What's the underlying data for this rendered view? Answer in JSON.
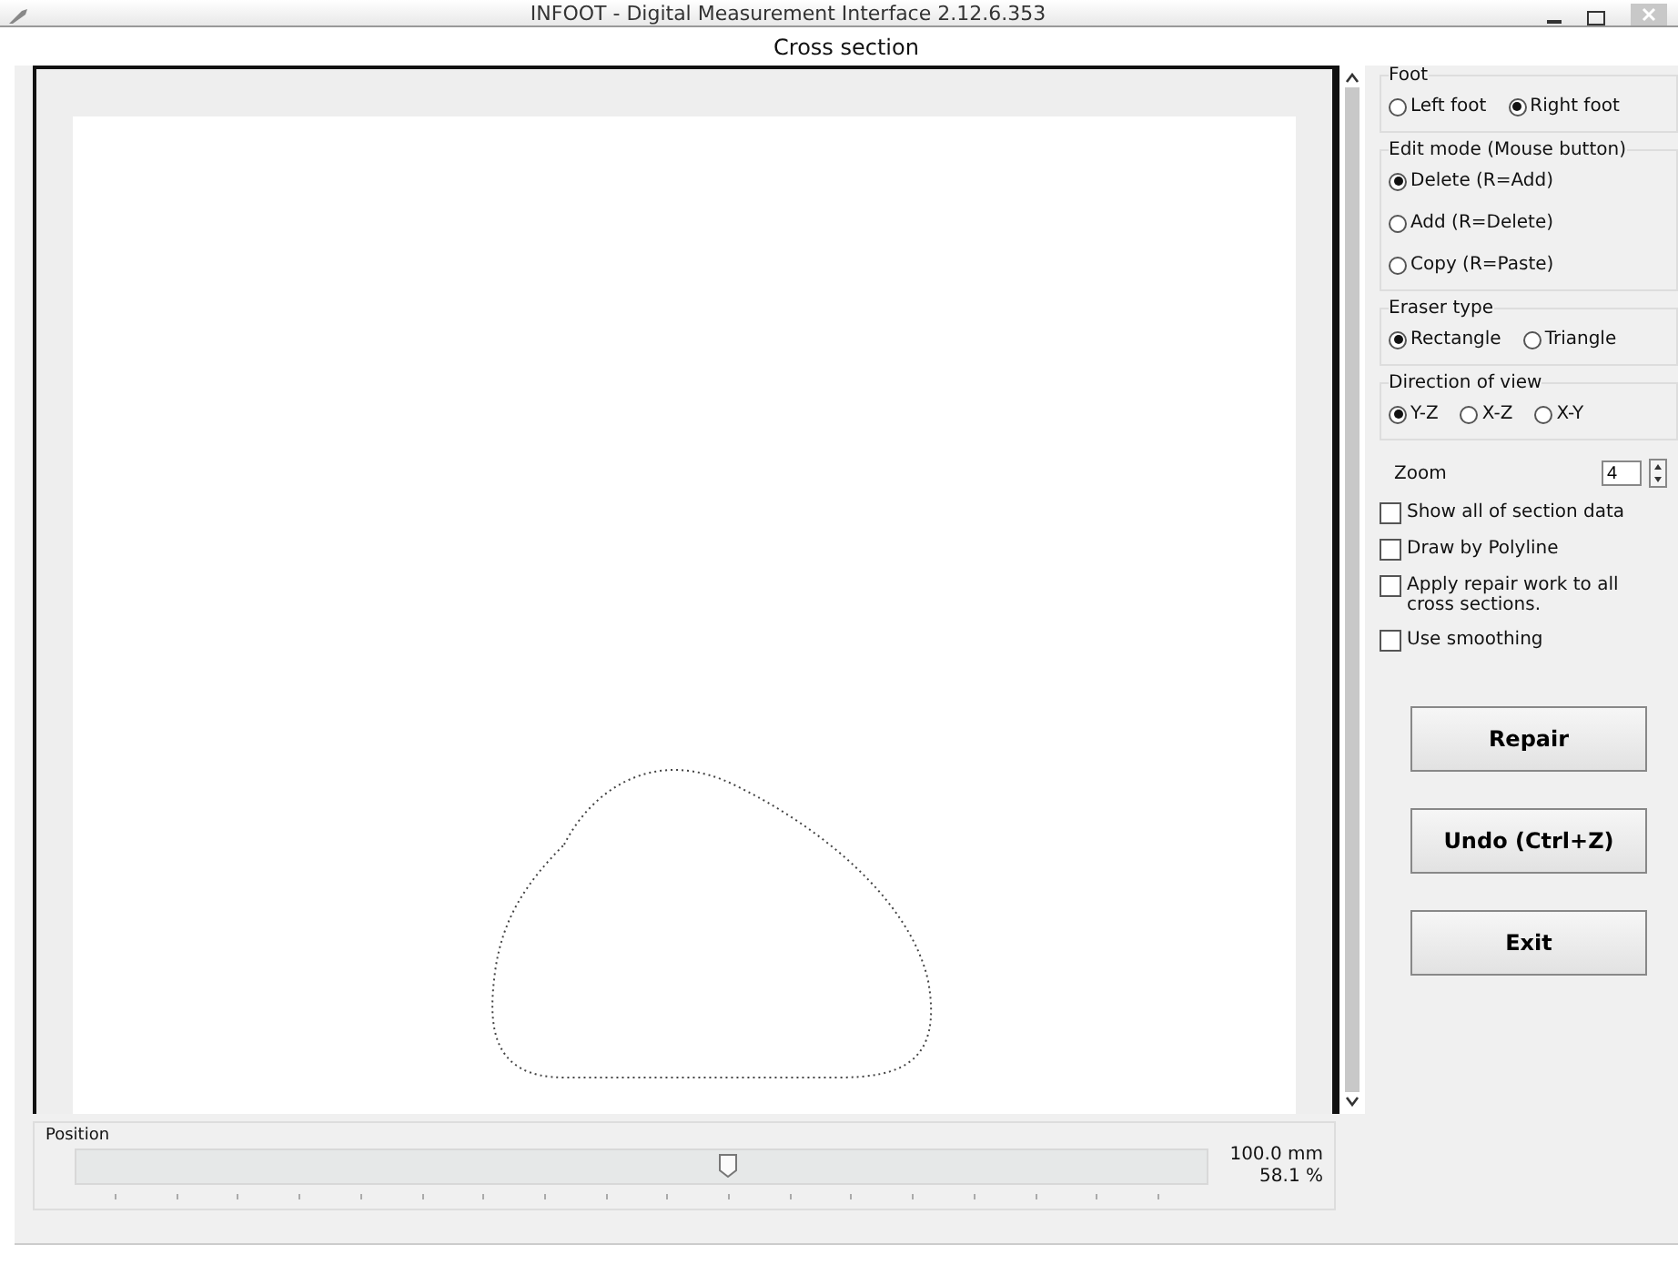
{
  "window": {
    "title": "INFOOT - Digital Measurement Interface 2.12.6.353",
    "subtitle": "Cross section"
  },
  "groups": [
    {
      "label": "Foot",
      "kind": "row",
      "options": [
        {
          "label": "Left foot",
          "selected": false
        },
        {
          "label": "Right foot",
          "selected": true
        }
      ]
    },
    {
      "label": "Edit mode (Mouse button)",
      "kind": "stack",
      "options": [
        {
          "label": "Delete (R=Add)",
          "selected": true
        },
        {
          "label": "Add (R=Delete)",
          "selected": false
        },
        {
          "label": "Copy (R=Paste)",
          "selected": false
        }
      ]
    },
    {
      "label": "Eraser type",
      "kind": "row",
      "options": [
        {
          "label": "Rectangle",
          "selected": true
        },
        {
          "label": "Triangle",
          "selected": false
        }
      ]
    },
    {
      "label": "Direction of view",
      "kind": "row",
      "options": [
        {
          "label": "Y-Z",
          "selected": true
        },
        {
          "label": "X-Z",
          "selected": false
        },
        {
          "label": "X-Y",
          "selected": false
        }
      ]
    }
  ],
  "zoom": {
    "label": "Zoom",
    "value": "4"
  },
  "checkboxes": [
    {
      "label": "Show all of section data",
      "checked": false
    },
    {
      "label": "Draw by Polyline",
      "checked": false
    },
    {
      "label": "Apply repair work to all cross sections.",
      "checked": false
    },
    {
      "label": "Use smoothing",
      "checked": false
    }
  ],
  "buttons": [
    "Repair",
    "Undo (Ctrl+Z)",
    "Exit"
  ],
  "position": {
    "label": "Position",
    "level": 0.577,
    "readings": [
      "100.0 mm",
      "58.1 %"
    ]
  }
}
